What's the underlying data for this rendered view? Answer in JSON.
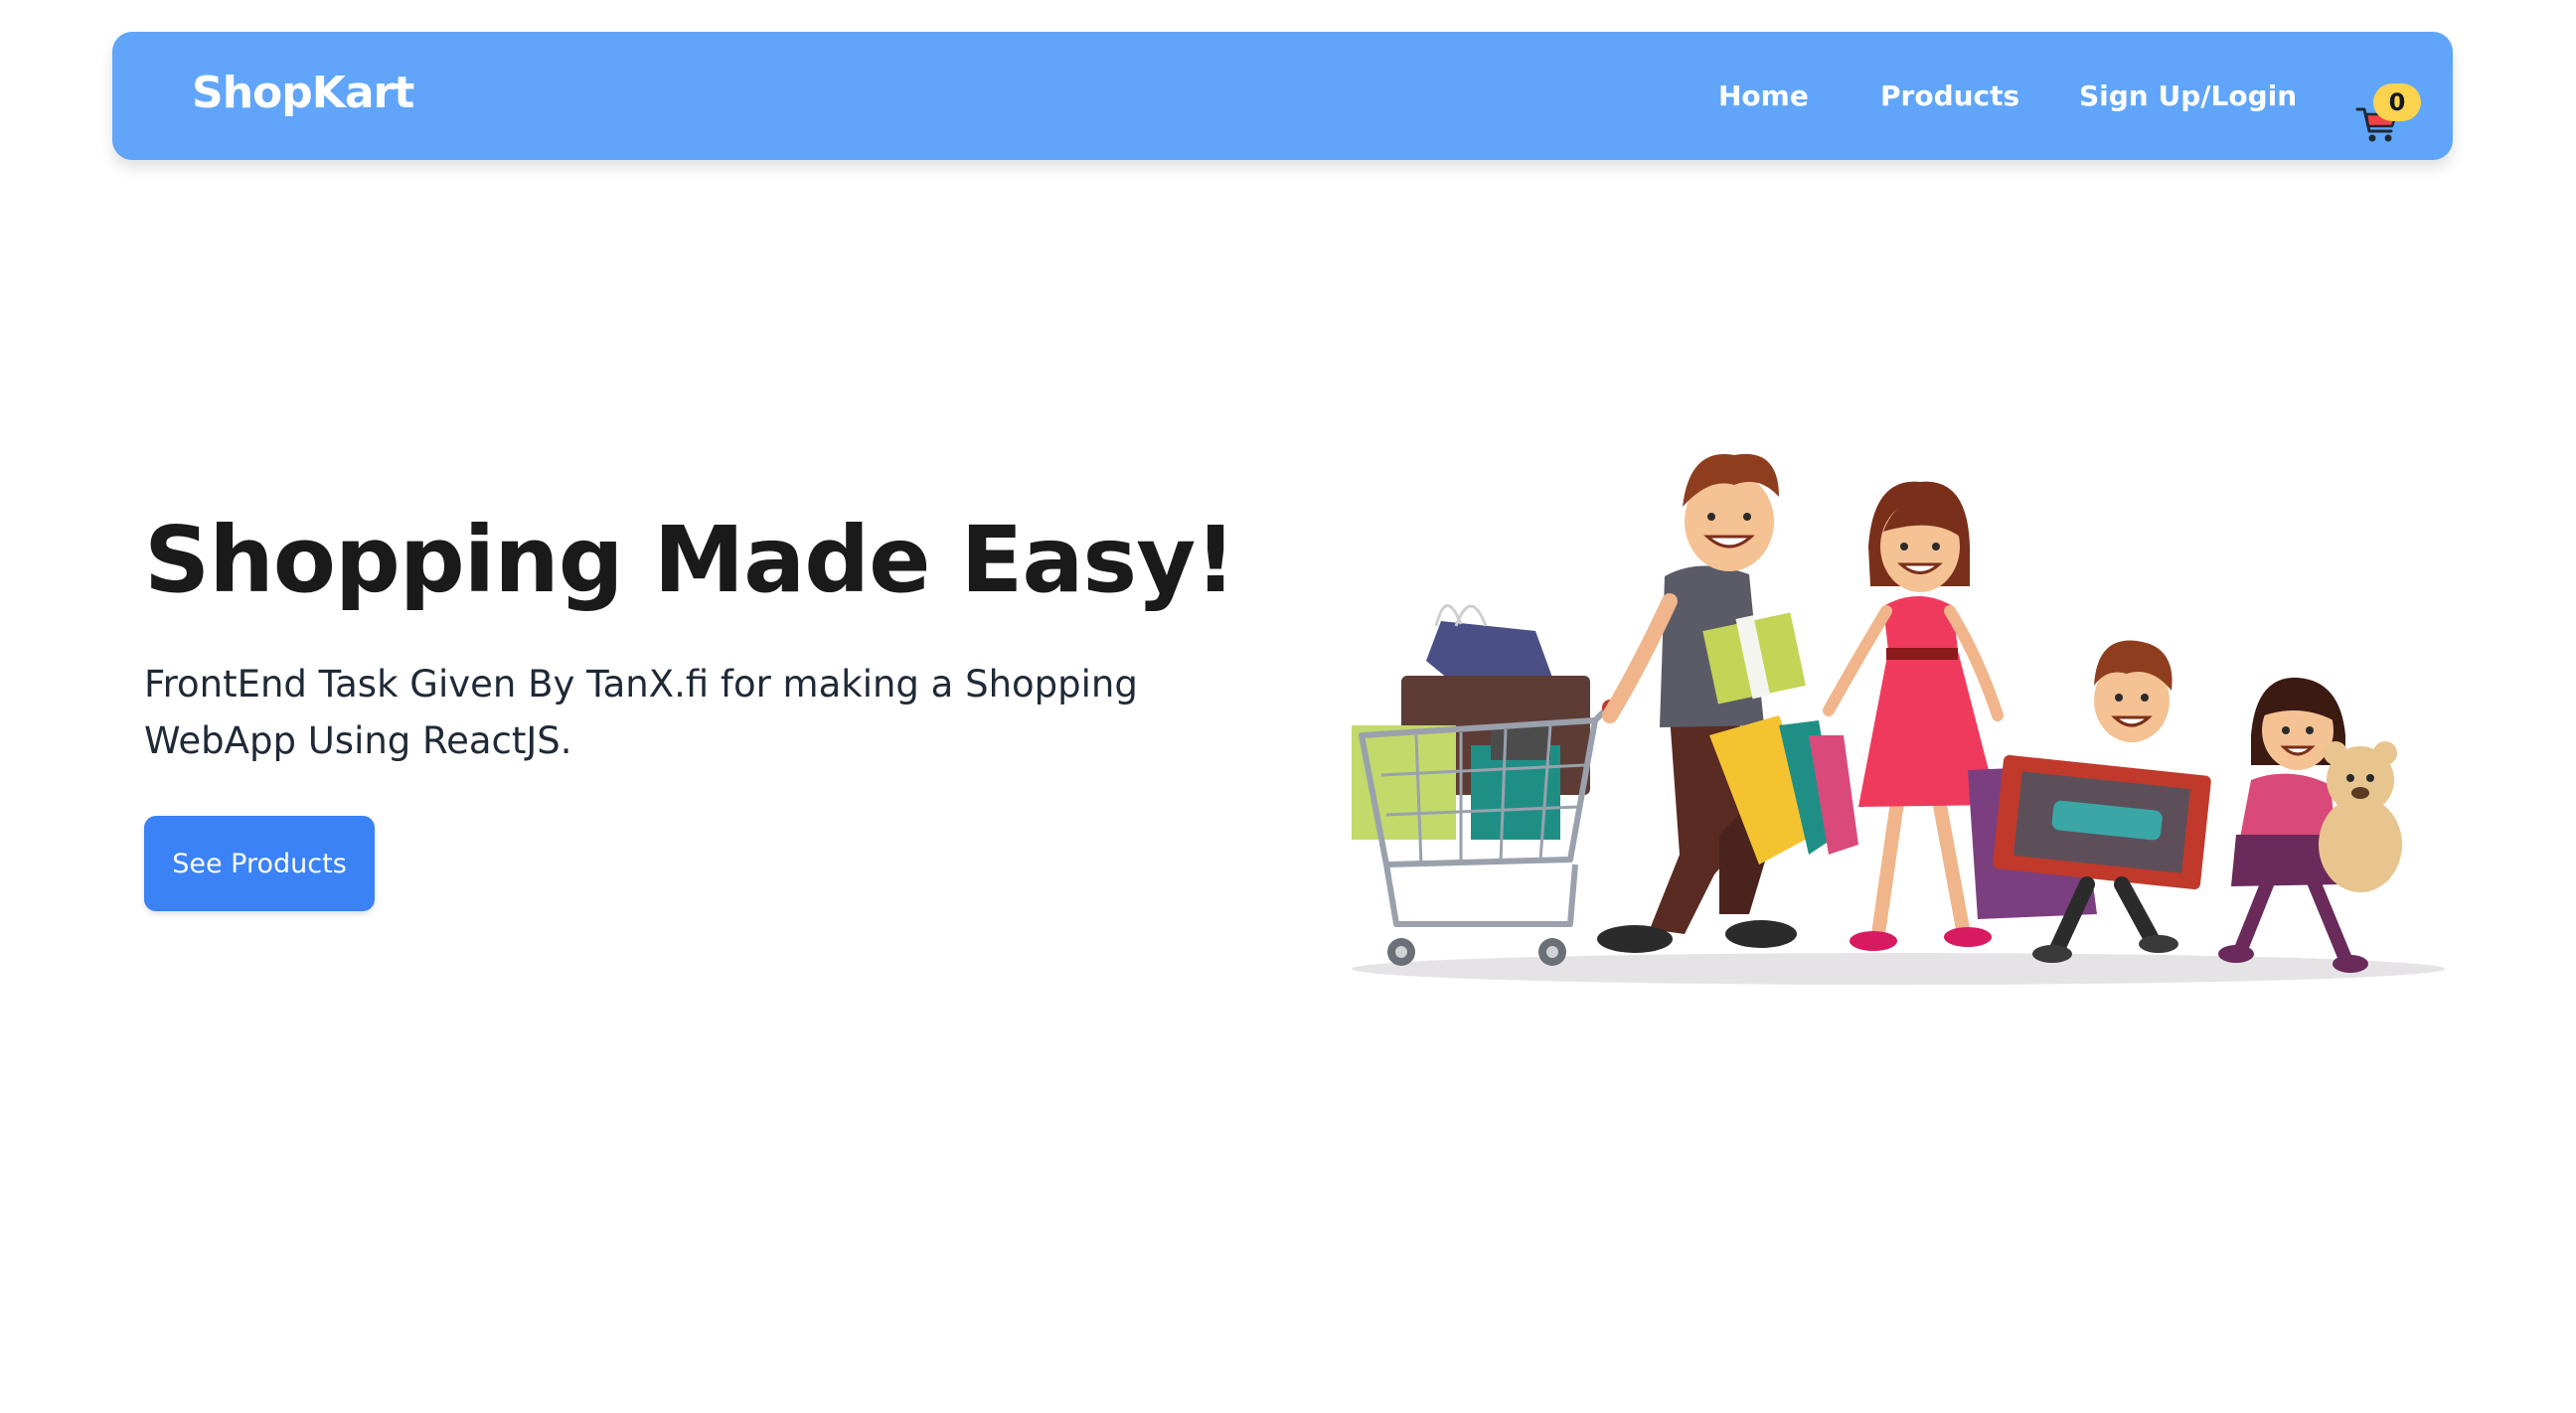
{
  "navbar": {
    "brand": "ShopKart",
    "links": [
      {
        "label": "Home"
      },
      {
        "label": "Products"
      },
      {
        "label": "Sign Up/Login"
      }
    ],
    "cart": {
      "icon": "shopping-cart-icon",
      "count": "0"
    }
  },
  "hero": {
    "title": "Shopping Made Easy!",
    "description": "FrontEnd Task Given By TanX.fi for making a Shopping WebApp Using ReactJS.",
    "button_label": "See Products",
    "illustration": "family-shopping-illustration"
  },
  "colors": {
    "navbar_bg": "#60a5fa",
    "button_bg": "#3b82f6",
    "badge_bg": "#fcd34d",
    "text_dark": "#1a1a1a"
  }
}
